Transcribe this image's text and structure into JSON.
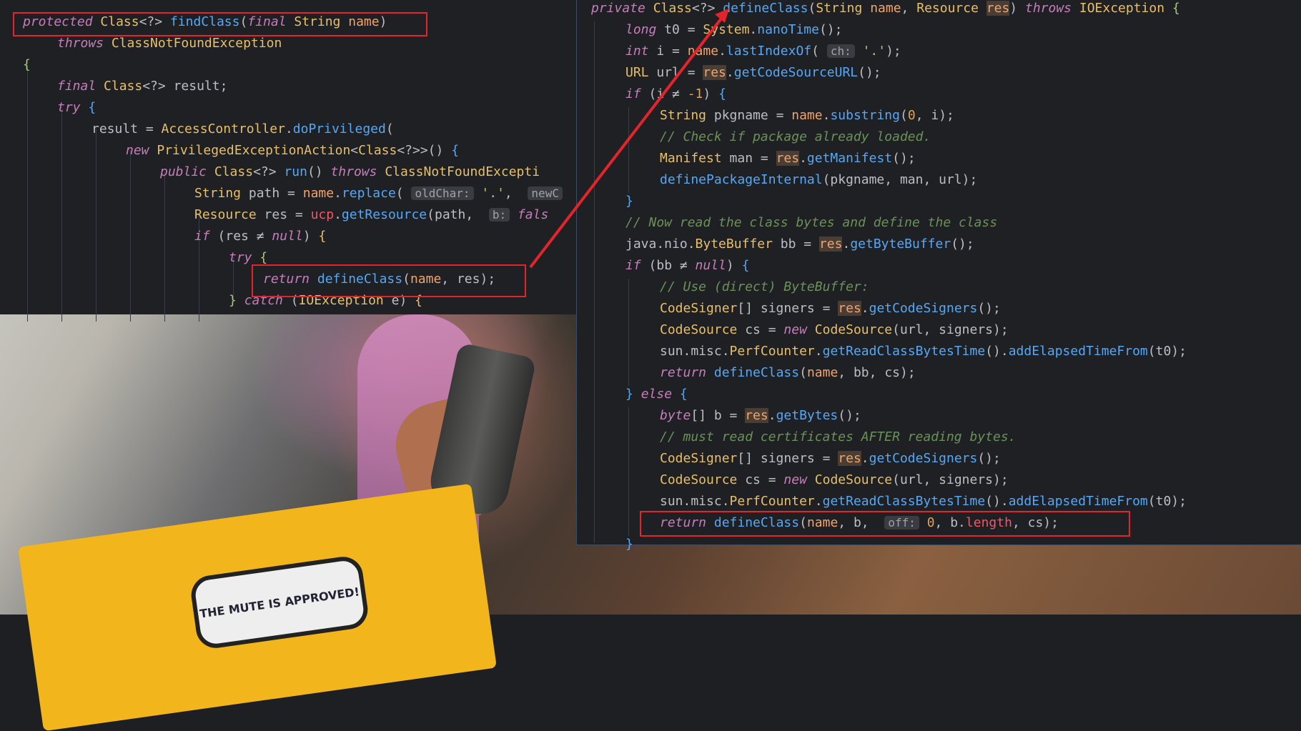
{
  "colors": {
    "keyword": "#c77dbb",
    "class": "#e8bf6a",
    "function": "#56a8f5",
    "param": "#f0a46f",
    "string": "#a6c97a",
    "comment": "#6b9158",
    "highlight_box": "#e3242b"
  },
  "photo": {
    "sticker_text": "THE MUTE IS APPROVED!"
  },
  "left_pane": {
    "lines": [
      "protected Class<?> findClass(final String name)",
      "throws ClassNotFoundException",
      "{",
      "final Class<?> result;",
      "try {",
      "result = AccessController.doPrivileged(",
      "new PrivilegedExceptionAction<Class<?>>() {",
      "public Class<?> run() throws ClassNotFoundExcepti",
      "String path = name.replace( oldChar: '.', newC",
      "Resource res = ucp.getResource(path,  b: fals",
      "if (res ≠ null) {",
      "try {",
      "return defineClass(name, res);",
      "} catch (IOException e) {"
    ],
    "hints": {
      "oldChar": "oldChar:",
      "newChar": "newC",
      "b": "b:"
    }
  },
  "right_pane": {
    "lines": [
      "private Class<?> defineClass(String name, Resource res) throws IOException {",
      "long t0 = System.nanoTime();",
      "int i = name.lastIndexOf( ch: '.');",
      "URL url = res.getCodeSourceURL();",
      "if (i ≠ -1) {",
      "String pkgname = name.substring(0, i);",
      "// Check if package already loaded.",
      "Manifest man = res.getManifest();",
      "definePackageInternal(pkgname, man, url);",
      "}",
      "// Now read the class bytes and define the class",
      "java.nio.ByteBuffer bb = res.getByteBuffer();",
      "if (bb ≠ null) {",
      "// Use (direct) ByteBuffer:",
      "CodeSigner[] signers = res.getCodeSigners();",
      "CodeSource cs = new CodeSource(url, signers);",
      "sun.misc.PerfCounter.getReadClassBytesTime().addElapsedTimeFrom(t0);",
      "return defineClass(name, bb, cs);",
      "} else {",
      "byte[] b = res.getBytes();",
      "// must read certificates AFTER reading bytes.",
      "CodeSigner[] signers = res.getCodeSigners();",
      "CodeSource cs = new CodeSource(url, signers);",
      "sun.misc.PerfCounter.getReadClassBytesTime().addElapsedTimeFrom(t0);",
      "return defineClass(name, b,  off: 0, b.length, cs);",
      "}"
    ],
    "hints": {
      "ch": "ch:",
      "off": "off:"
    }
  }
}
